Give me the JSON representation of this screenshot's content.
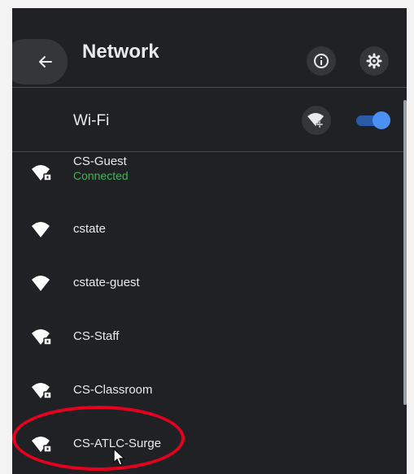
{
  "header": {
    "title": "Network"
  },
  "wifi": {
    "label": "Wi-Fi",
    "enabled": true
  },
  "networks": [
    {
      "name": "CS-Guest",
      "status": "Connected",
      "secured": true
    },
    {
      "name": "cstate",
      "status": "",
      "secured": false
    },
    {
      "name": "cstate-guest",
      "status": "",
      "secured": false
    },
    {
      "name": "CS-Staff",
      "status": "",
      "secured": true
    },
    {
      "name": "CS-Classroom",
      "status": "",
      "secured": true
    },
    {
      "name": "CS-ATLC-Surge",
      "status": "",
      "secured": true
    }
  ],
  "colors": {
    "panel_bg": "#202124",
    "text": "#e8eaed",
    "connected": "#3fb55a",
    "toggle_accent": "#4a90f5",
    "annotation": "#e6001f"
  },
  "icons": {
    "back": "arrow-left-icon",
    "info": "info-icon",
    "settings": "gear-icon",
    "add_network": "wifi-add-icon",
    "wifi_locked": "wifi-lock-icon",
    "wifi_open": "wifi-icon"
  }
}
